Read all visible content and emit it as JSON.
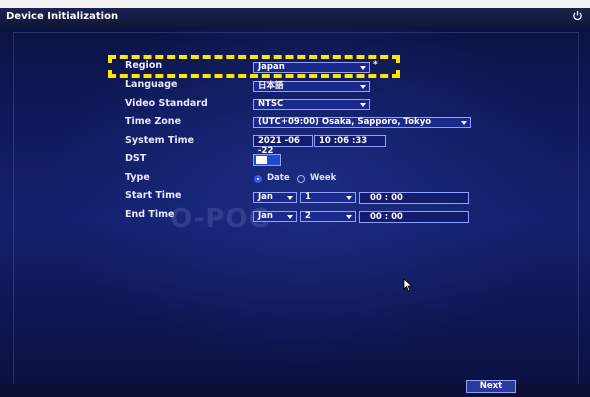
{
  "window": {
    "title": "Device Initialization"
  },
  "form": {
    "region": {
      "label": "Region",
      "value": "Japan",
      "required_mark": "*"
    },
    "language": {
      "label": "Language",
      "value": "日本語"
    },
    "video_standard": {
      "label": "Video Standard",
      "value": "NTSC"
    },
    "time_zone": {
      "label": "Time Zone",
      "value": "(UTC+09:00) Osaka, Sapporo, Tokyo"
    },
    "system_time": {
      "label": "System Time",
      "date": "2021 -06 -22",
      "time": "10 :06 :33"
    },
    "dst": {
      "label": "DST",
      "enabled": true
    },
    "type": {
      "label": "Type",
      "options": [
        "Date",
        "Week"
      ],
      "selected": "Date"
    },
    "start_time": {
      "label": "Start Time",
      "month": "Jan",
      "day": "1",
      "time": "00 : 00"
    },
    "end_time": {
      "label": "End Time",
      "month": "Jan",
      "day": "2",
      "time": "00 : 00"
    }
  },
  "footer": {
    "next_label": "Next"
  },
  "watermark": "O-POG",
  "icons": {
    "power": "power-icon",
    "cursor": "mouse-cursor-icon"
  },
  "colors": {
    "highlight": "#ffe600",
    "background": "#0f1a5c",
    "field": "#1b2a8a"
  }
}
